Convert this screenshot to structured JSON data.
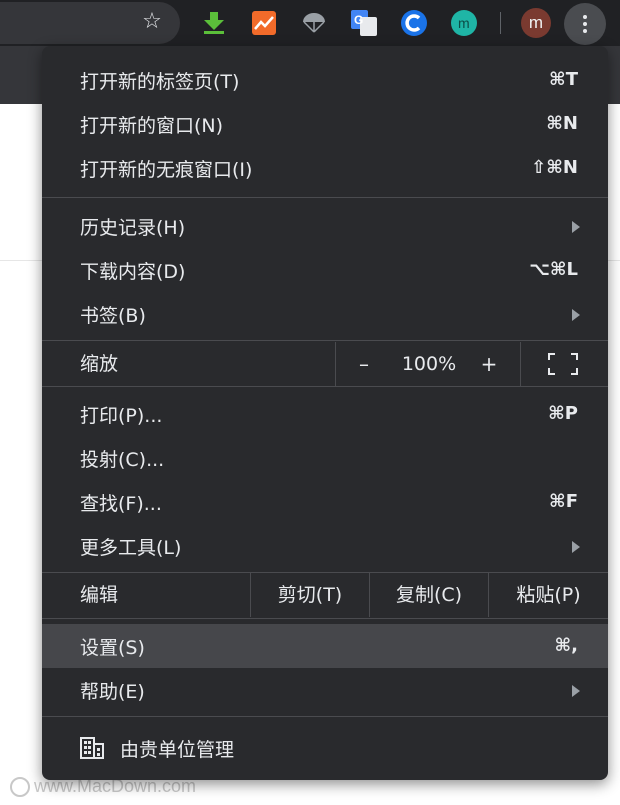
{
  "toolbar": {
    "avatar_letter": "m",
    "extensions": [
      "download-arrow-extension",
      "chart-extension",
      "parachute-extension",
      "translate-extension",
      "c-logo-extension",
      "m-logo-extension"
    ],
    "m_ext_letter": "m",
    "translate_letter": "G"
  },
  "menu": {
    "new_tab": {
      "label": "打开新的标签页(T)",
      "shortcut": "⌘T"
    },
    "new_window": {
      "label": "打开新的窗口(N)",
      "shortcut": "⌘N"
    },
    "new_incognito": {
      "label": "打开新的无痕窗口(I)",
      "shortcut": "⇧⌘N"
    },
    "history": {
      "label": "历史记录(H)"
    },
    "downloads": {
      "label": "下载内容(D)",
      "shortcut": "⌥⌘L"
    },
    "bookmarks": {
      "label": "书签(B)"
    },
    "zoom": {
      "label": "缩放",
      "minus": "–",
      "value": "100%",
      "plus": "+"
    },
    "print": {
      "label": "打印(P)...",
      "shortcut": "⌘P"
    },
    "cast": {
      "label": "投射(C)..."
    },
    "find": {
      "label": "查找(F)...",
      "shortcut": "⌘F"
    },
    "more_tools": {
      "label": "更多工具(L)"
    },
    "edit": {
      "label": "编辑",
      "cut": "剪切(T)",
      "copy": "复制(C)",
      "paste": "粘贴(P)"
    },
    "settings": {
      "label": "设置(S)",
      "shortcut": "⌘,"
    },
    "help": {
      "label": "帮助(E)"
    },
    "managed": {
      "label": "由贵单位管理"
    }
  },
  "watermark": {
    "text": "www.MacDown.com"
  },
  "colors": {
    "menu_bg": "#292a2d",
    "highlight": "#46474b",
    "toolbar": "#202124",
    "text": "#e8eaed"
  }
}
